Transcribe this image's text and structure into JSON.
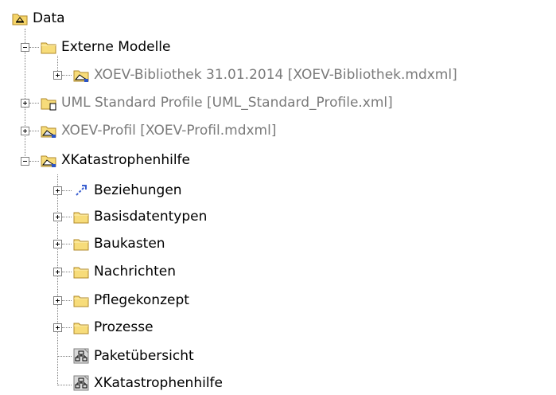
{
  "tree": {
    "root": {
      "label": "Data",
      "icon": "package-folder-icon"
    },
    "externe": {
      "label": "Externe Modelle",
      "icon": "folder-icon"
    },
    "xoev_bib": {
      "label": "XOEV-Bibliothek 31.01.2014 [XOEV-Bibliothek.mdxml]",
      "icon": "shared-package-icon"
    },
    "uml_std": {
      "label": "UML Standard Profile [UML_Standard_Profile.xml]",
      "icon": "profile-package-icon"
    },
    "xoev_profil": {
      "label": "XOEV-Profil [XOEV-Profil.mdxml]",
      "icon": "shared-package-icon"
    },
    "xkat": {
      "label": "XKatastrophenhilfe",
      "icon": "shared-package-icon"
    },
    "beziehungen": {
      "label": "Beziehungen",
      "icon": "relation-icon"
    },
    "basisdatentypen": {
      "label": "Basisdatentypen",
      "icon": "folder-icon"
    },
    "baukasten": {
      "label": "Baukasten",
      "icon": "folder-icon"
    },
    "nachrichten": {
      "label": "Nachrichten",
      "icon": "folder-icon"
    },
    "pflegekonzept": {
      "label": "Pflegekonzept",
      "icon": "folder-icon"
    },
    "prozesse": {
      "label": "Prozesse",
      "icon": "folder-icon"
    },
    "paketuebersicht": {
      "label": "Paketübersicht",
      "icon": "package-diagram-icon"
    },
    "xkat_diagram": {
      "label": "XKatastrophenhilfe",
      "icon": "package-diagram-icon"
    }
  }
}
